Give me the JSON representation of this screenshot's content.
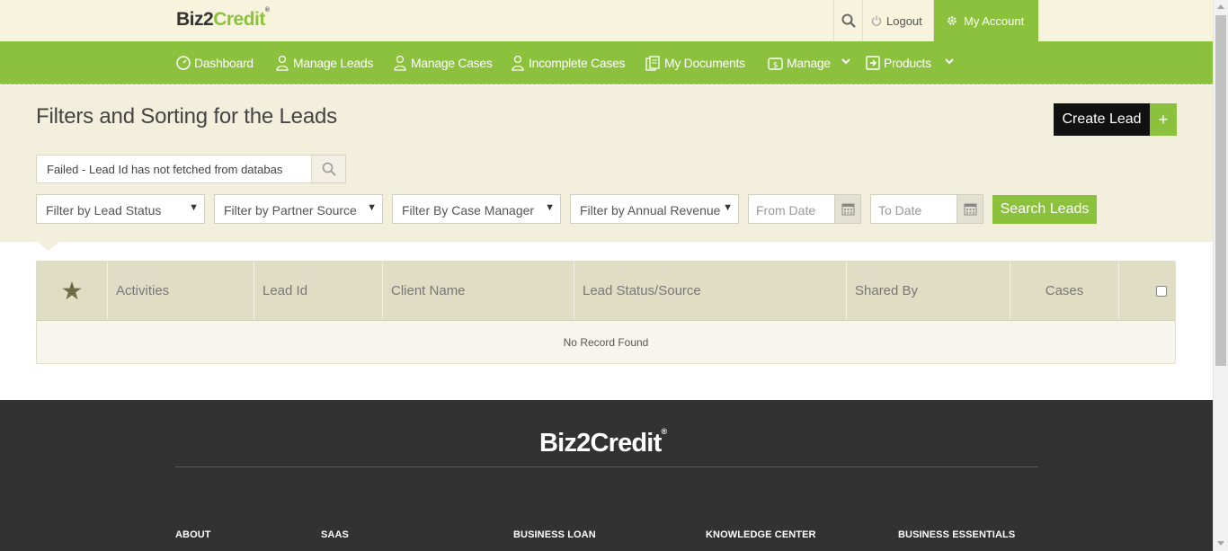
{
  "brand": {
    "logo_part1": "Biz2",
    "logo_part2": "Credit",
    "registered": "®"
  },
  "topbar": {
    "logout_label": "Logout",
    "account_label": "My Account"
  },
  "nav": {
    "dashboard": "Dashboard",
    "manage_leads": "Manage Leads",
    "manage_cases": "Manage Cases",
    "incomplete_cases": "Incomplete Cases",
    "my_documents": "My Documents",
    "manage": "Manage",
    "products": "Products"
  },
  "filters": {
    "title": "Filters and Sorting for the Leads",
    "create_lead_label": "Create Lead",
    "create_plus": "+",
    "search_value": "Failed - Lead Id has not fetched from databas",
    "lead_status": "Filter by Lead Status",
    "partner_source": "Filter by Partner Source",
    "case_manager": "Filter By Case Manager",
    "annual_revenue": "Filter by Annual Revenue",
    "from_date_placeholder": "From Date",
    "to_date_placeholder": "To Date",
    "search_leads_label": "Search Leads"
  },
  "table": {
    "columns": [
      "Activities",
      "Lead Id",
      "Client Name",
      "Lead Status/Source",
      "Shared By",
      "Cases"
    ],
    "empty_message": "No Record Found"
  },
  "footer": {
    "headings": [
      "ABOUT",
      "SAAS",
      "BUSINESS LOAN",
      "KNOWLEDGE CENTER",
      "BUSINESS ESSENTIALS"
    ]
  },
  "colors": {
    "brand_green": "#8bc13c",
    "cream": "#f7f3dc",
    "footer_dark": "#323232"
  }
}
